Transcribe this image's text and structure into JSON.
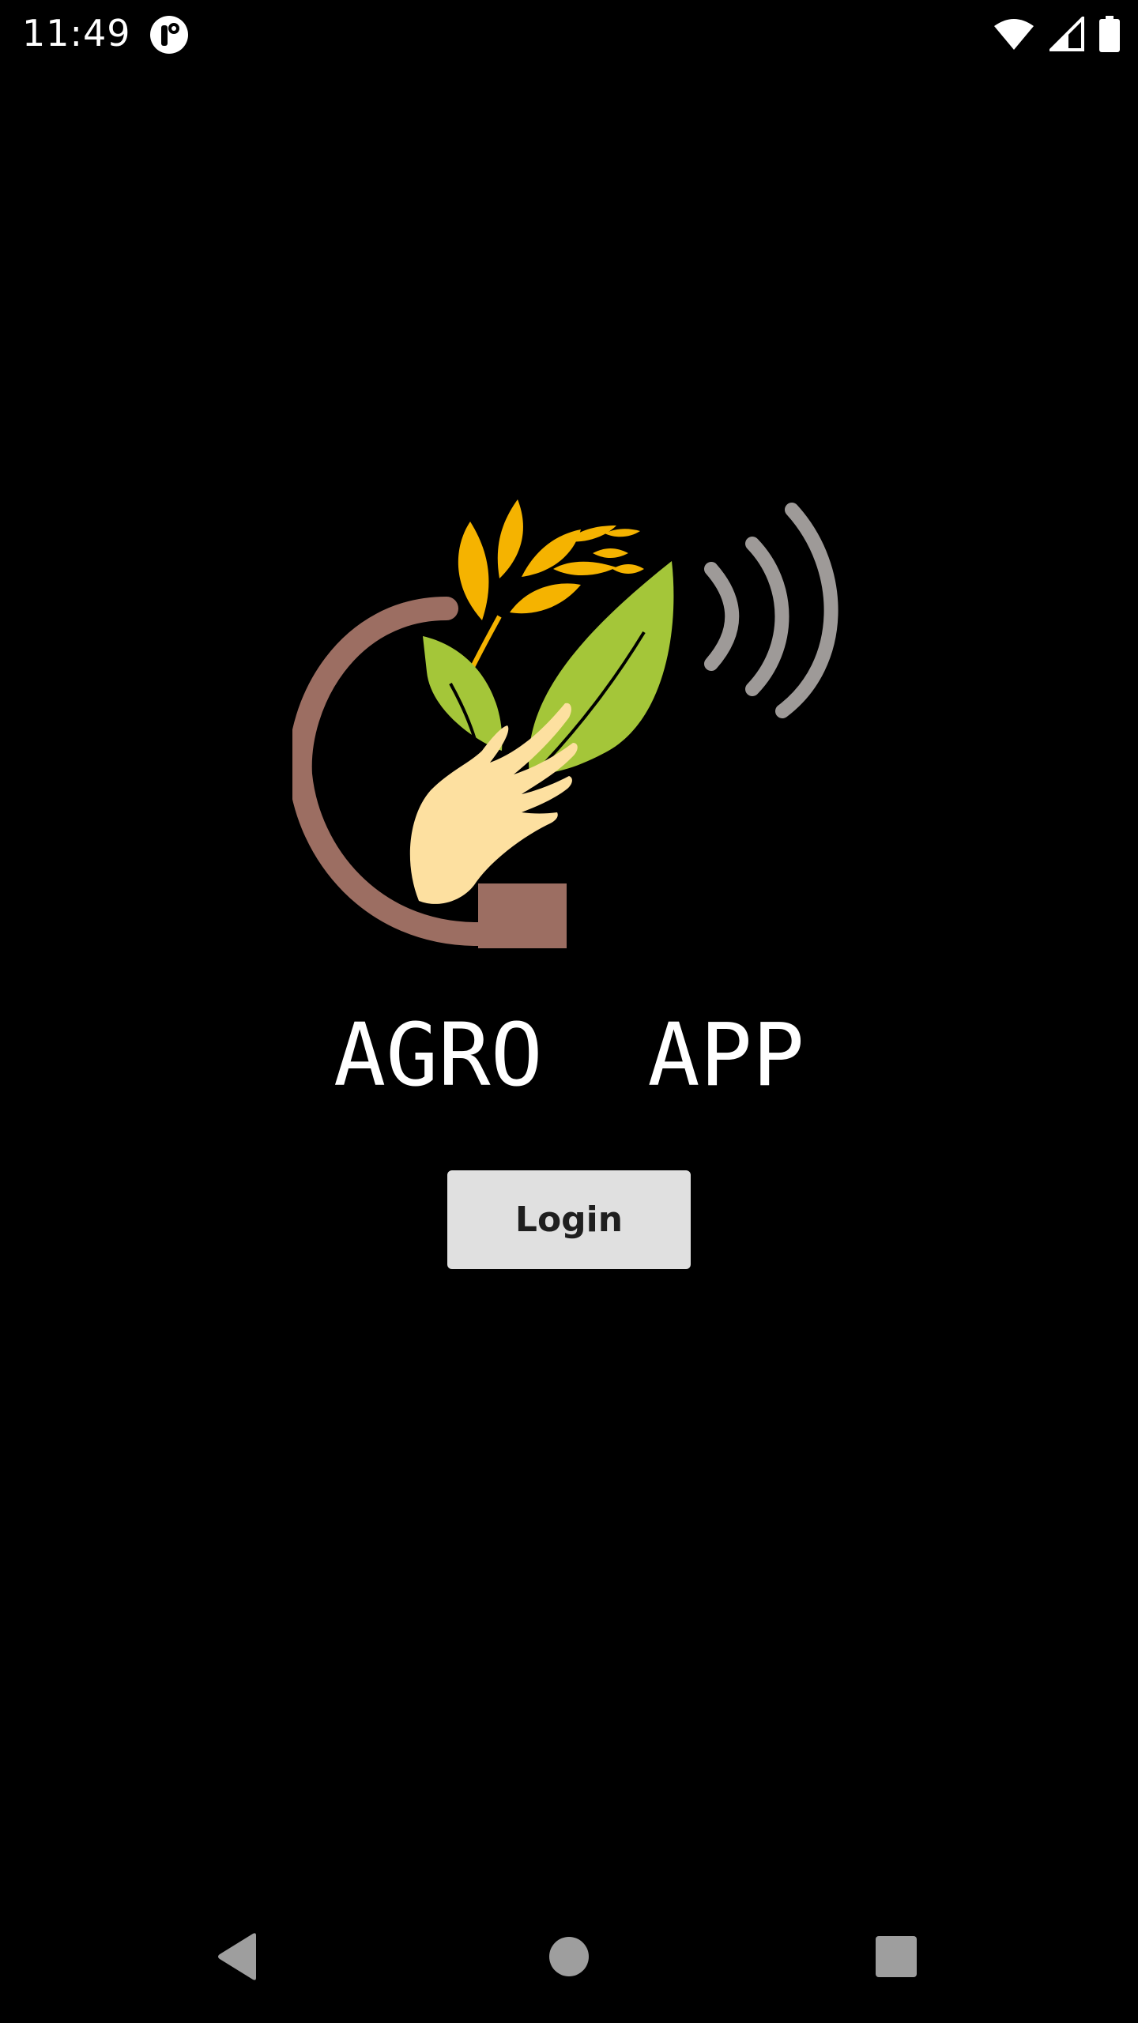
{
  "status_bar": {
    "time": "11:49",
    "notification_icon": "app-notification-icon",
    "icons": [
      "wifi-icon",
      "cell-signal-icon",
      "battery-icon"
    ]
  },
  "app": {
    "title": "AGRO  APP",
    "login_label": "Login"
  },
  "logo": {
    "icon": "agro-app-logo",
    "colors": {
      "grain": "#f5b300",
      "leaf": "#a4c639",
      "hand": "#fde0a0",
      "ring": "#9c6e62",
      "signal": "#9e9a98"
    }
  },
  "nav_bar": {
    "back": "back-icon",
    "home": "home-icon",
    "recents": "recents-icon"
  },
  "colors": {
    "background": "#000000",
    "button_bg": "#e0e0e0",
    "button_text": "#1f1f1f"
  }
}
